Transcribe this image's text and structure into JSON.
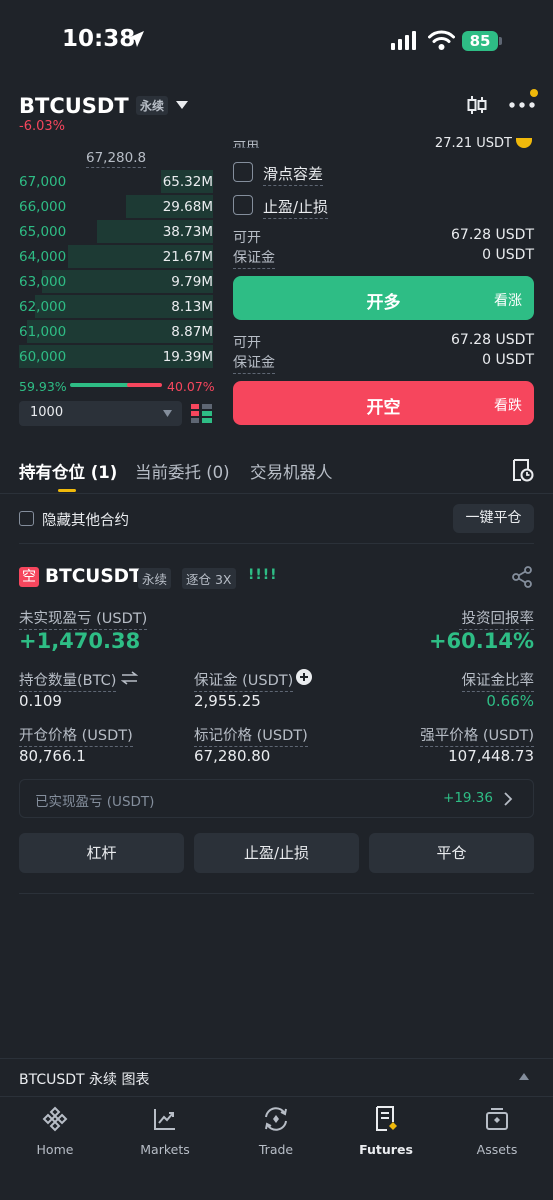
{
  "status": {
    "time": "10:38",
    "battery": "85"
  },
  "header": {
    "symbol": "BTCUSDT",
    "contract_tag": "永续",
    "change": "-6.03%"
  },
  "orderbook": {
    "mark_price": "67,280.8",
    "rows": [
      {
        "price": "67,000",
        "qty": "65.32M",
        "fill": 0.27
      },
      {
        "price": "66,000",
        "qty": "29.68M",
        "fill": 0.45
      },
      {
        "price": "65,000",
        "qty": "38.73M",
        "fill": 0.6
      },
      {
        "price": "64,000",
        "qty": "21.67M",
        "fill": 0.75
      },
      {
        "price": "63,000",
        "qty": "9.79M",
        "fill": 0.88
      },
      {
        "price": "62,000",
        "qty": "8.13M",
        "fill": 0.92
      },
      {
        "price": "61,000",
        "qty": "8.87M",
        "fill": 0.96
      },
      {
        "price": "60,000",
        "qty": "19.39M",
        "fill": 1.0
      }
    ],
    "buy_ratio": "59.93%",
    "sell_ratio": "40.07%",
    "depth_value": "1000"
  },
  "form": {
    "available_top": "可用",
    "available_top_value": "27.21 USDT",
    "slippage_label": "滑点容差",
    "tpsl_label": "止盈/止损",
    "long": {
      "can_open_label": "可开",
      "can_open_value": "67.28 USDT",
      "margin_label": "保证金",
      "margin_value": "0 USDT",
      "button": "开多",
      "button_sub": "看涨"
    },
    "short": {
      "can_open_label": "可开",
      "can_open_value": "67.28 USDT",
      "margin_label": "保证金",
      "margin_value": "0 USDT",
      "button": "开空",
      "button_sub": "看跌"
    }
  },
  "tabs": [
    {
      "label": "持有仓位 (1)"
    },
    {
      "label": "当前委托 (0)"
    },
    {
      "label": "交易机器人"
    }
  ],
  "filter": {
    "hide_others": "隐藏其他合约",
    "close_all": "一键平仓"
  },
  "position": {
    "side_badge": "空",
    "symbol": "BTCUSDT",
    "tag1": "永续",
    "tag2": "逐仓 3X",
    "signal": "!!!!",
    "pnl_label": "未实现盈亏 (USDT)",
    "pnl_value": "+1,470.38",
    "roi_label": "投资回报率",
    "roi_value": "+60.14%",
    "size_label": "持仓数量(BTC)",
    "size_value": "0.109",
    "margin_label": "保证金 (USDT)",
    "margin_value": "2,955.25",
    "margin_ratio_label": "保证金比率",
    "margin_ratio_value": "0.66%",
    "entry_label": "开仓价格 (USDT)",
    "entry_value": "80,766.1",
    "mark_label": "标记价格 (USDT)",
    "mark_value": "67,280.80",
    "liq_label": "强平价格 (USDT)",
    "liq_value": "107,448.73",
    "realized_label": "已实现盈亏 (USDT)",
    "realized_value": "+19.36",
    "btn_leverage": "杠杆",
    "btn_tpsl": "止盈/止损",
    "btn_close": "平仓"
  },
  "chart_bar": {
    "label": "BTCUSDT 永续 图表"
  },
  "nav": [
    {
      "label": "Home"
    },
    {
      "label": "Markets"
    },
    {
      "label": "Trade"
    },
    {
      "label": "Futures"
    },
    {
      "label": "Assets"
    }
  ],
  "colors": {
    "green": "#2ebd85",
    "red": "#f6465d",
    "accent": "#f0b90b",
    "bg": "#1f2329"
  }
}
